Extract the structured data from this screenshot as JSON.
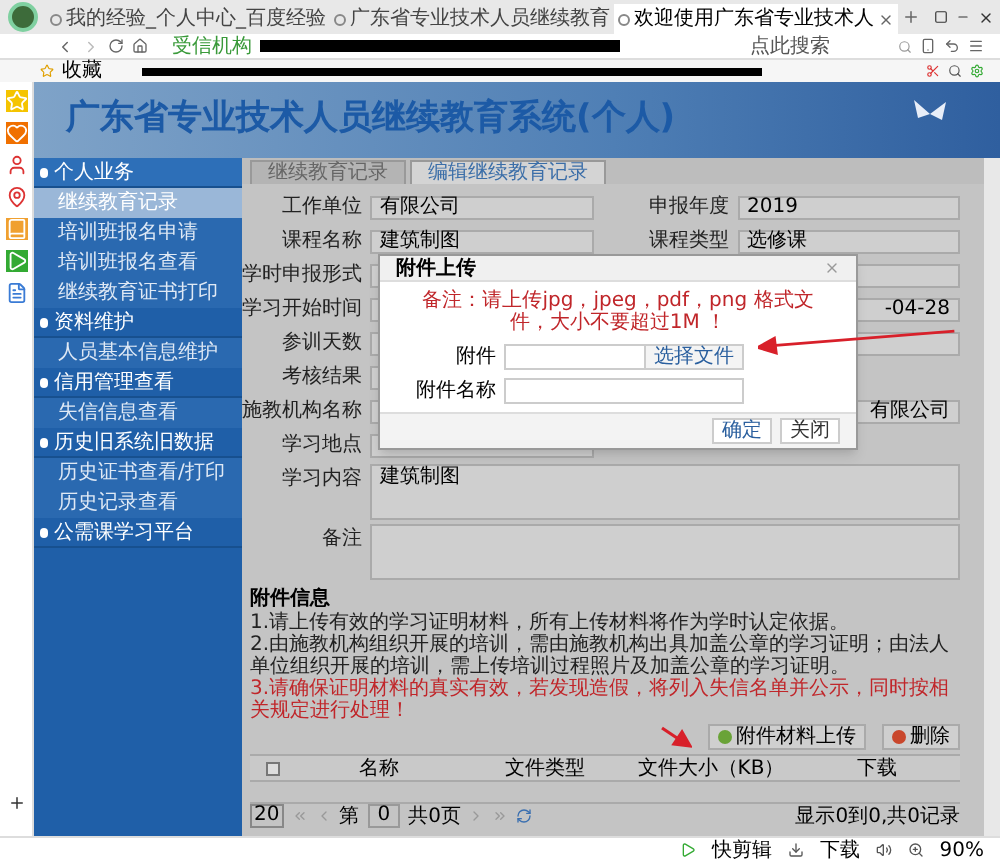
{
  "browser": {
    "tabs": [
      {
        "title": "我的经验_个人中心_百度经验",
        "selected": false
      },
      {
        "title": "广东省专业技术人员继续教育",
        "selected": false
      },
      {
        "title": "欢迎使用广东省专业技术人",
        "selected": true
      }
    ],
    "address_badge": "受信机构",
    "search_placeholder": "点此搜索",
    "bookmarks_label": "收藏"
  },
  "banner": {
    "title": "广东省专业技术人员继续教育系统(个人)"
  },
  "sidebar": {
    "groups": [
      {
        "label": "个人业务",
        "selected": true,
        "children": [
          {
            "label": "继续教育记录",
            "selected": true
          },
          {
            "label": "培训班报名申请",
            "selected": false
          },
          {
            "label": "培训班报名查看",
            "selected": false
          },
          {
            "label": "继续教育证书打印",
            "selected": false
          }
        ]
      },
      {
        "label": "资料维护",
        "selected": false,
        "children": [
          {
            "label": "人员基本信息维护",
            "selected": false
          }
        ]
      },
      {
        "label": "信用管理查看",
        "selected": false,
        "children": [
          {
            "label": "失信信息查看",
            "selected": false
          }
        ]
      },
      {
        "label": "历史旧系统旧数据",
        "selected": false,
        "children": [
          {
            "label": "历史证书查看/打印",
            "selected": false
          },
          {
            "label": "历史记录查看",
            "selected": false
          }
        ]
      },
      {
        "label": "公需课学习平台",
        "selected": false
      }
    ]
  },
  "content_tabs": [
    {
      "label": "继续教育记录",
      "selected": false
    },
    {
      "label": "编辑继续教育记录",
      "selected": true
    }
  ],
  "form": {
    "rows": [
      {
        "left": {
          "label": "工作单位",
          "value": "有限公司",
          "kind": "text"
        },
        "right": {
          "label": "申报年度",
          "value": "2019",
          "kind": "select"
        }
      },
      {
        "left": {
          "label": "课程名称",
          "value": "建筑制图",
          "kind": "text"
        },
        "right": {
          "label": "课程类型",
          "value": "选修课",
          "kind": "select"
        }
      },
      {
        "left": {
          "label": "学时申报形式",
          "kind": "text"
        },
        "right": {
          "kind": "text"
        }
      },
      {
        "left": {
          "label": "学习开始时间",
          "kind": "text"
        },
        "right": {
          "value": "-04-28",
          "kind": "date"
        }
      },
      {
        "left": {
          "label": "参训天数",
          "kind": "text"
        },
        "right": {
          "kind": "text"
        }
      },
      {
        "left": {
          "label": "考核结果",
          "kind": "text"
        }
      },
      {
        "left": {
          "label": "施教机构名称",
          "value": "有限公司",
          "kind": "wide"
        }
      },
      {
        "left": {
          "label": "学习地点",
          "kind": "text"
        }
      },
      {
        "left": {
          "label": "学习内容",
          "value": "建筑制图",
          "kind": "textarea"
        }
      },
      {
        "left": {
          "label": "备注",
          "kind": "textarea"
        }
      }
    ]
  },
  "dialog": {
    "title": "附件上传",
    "note": "备注：请上传jpg，jpeg，pdf，png 格式文件，大小不要超过1M ！",
    "file_label": "附件",
    "choose_button": "选择文件",
    "name_label": "附件名称",
    "buttons": [
      "确定",
      "关闭"
    ]
  },
  "attachments": {
    "title": "附件信息",
    "notes": [
      {
        "text": "1.请上传有效的学习证明材料，所有上传材料将作为学时认定依据。",
        "warning": false
      },
      {
        "text": "2.由施教机构组织开展的培训，需由施教机构出具加盖公章的学习证明；由法人单位组织开展的培训，需上传培训过程照片及加盖公章的学习证明。",
        "warning": false
      },
      {
        "text": "3.请确保证明材料的真实有效，若发现造假，将列入失信名单并公示，同时按相关规定进行处理！",
        "warning": true
      }
    ],
    "buttons": [
      {
        "label": "附件材料上传",
        "kind": "add"
      },
      {
        "label": "删除",
        "kind": "delete"
      }
    ],
    "select_all_checked": false,
    "columns": [
      "名称",
      "文件类型",
      "文件大小（KB）",
      "下载"
    ],
    "pager": {
      "page_size": "20",
      "page_label": "第",
      "page": "0",
      "total_pages": "共0页",
      "summary": "显示0到0,共0记录"
    }
  },
  "status_bar": {
    "items": [
      "快剪辑",
      "下载",
      "90%"
    ]
  }
}
